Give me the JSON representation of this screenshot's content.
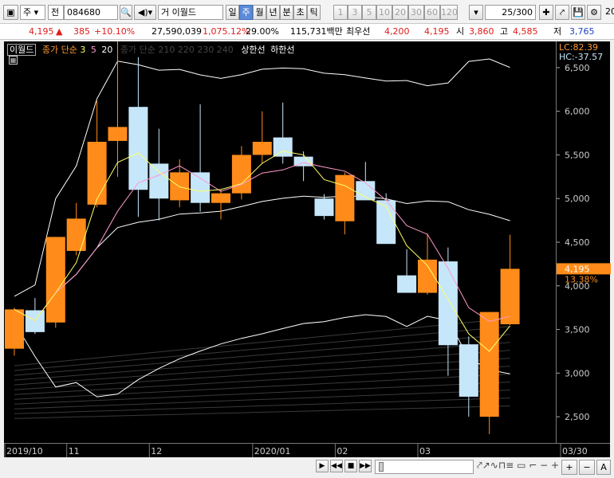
{
  "toolbar": {
    "market": "주",
    "all_label": "전",
    "code": "084680",
    "name": "거 이월드",
    "periods": [
      "일",
      "주",
      "월",
      "년",
      "분",
      "초",
      "틱"
    ],
    "selected_period": "주",
    "intervals": [
      "1",
      "3",
      "5",
      "10",
      "20",
      "30",
      "60",
      "120"
    ],
    "count": "25/300",
    "right_num": "20"
  },
  "quote": {
    "price": "4,195",
    "change": "385",
    "change_pct": "+10.10%",
    "volume": "27,590,039",
    "vol_ratio": "1,075.12%",
    "turnover": "29.00%",
    "amount": "115,731백만",
    "best_ask_label": "최우선",
    "best_ask": "4,200",
    "best_bid": "4,195",
    "open_label": "시",
    "open": "3,860",
    "high_label": "고",
    "high": "4,585",
    "low_label": "저",
    "low": "3,765"
  },
  "legend": {
    "name": "이월드",
    "ma_label": "종가 단순",
    "ma_periods": [
      "3",
      "5",
      "20"
    ],
    "ma_periods2": "종가 단순 210  220  230  240",
    "upper": "상한선",
    "lower": "하한선"
  },
  "axis_info": {
    "lc": "LC:82.39",
    "hc": "HC:-37.57",
    "current": "4,195",
    "current_pct": "13.38%"
  },
  "colors": {
    "up": "#ff8c1a",
    "down": "#c6e6fa",
    "bg": "#000000",
    "ma3": "#ffff66",
    "ma5": "#ff99cc",
    "band": "#ffffff"
  },
  "chart_data": {
    "type": "candlestick",
    "ylim": [
      2200,
      6800
    ],
    "yticks": [
      2500,
      3000,
      3500,
      4000,
      4500,
      5000,
      5500,
      6000,
      6500
    ],
    "x_labels": [
      {
        "label": "2019/10",
        "index": 0
      },
      {
        "label": "11",
        "index": 3
      },
      {
        "label": "12",
        "index": 7
      },
      {
        "label": "2020/01",
        "index": 12
      },
      {
        "label": "02",
        "index": 16
      },
      {
        "label": "03",
        "index": 20
      },
      {
        "label": "03/30",
        "index": 27
      }
    ],
    "candles": [
      {
        "o": 3280,
        "h": 3750,
        "l": 3200,
        "c": 3730
      },
      {
        "o": 3720,
        "h": 3860,
        "l": 3450,
        "c": 3470
      },
      {
        "o": 3580,
        "h": 4560,
        "l": 3520,
        "c": 4560
      },
      {
        "o": 4400,
        "h": 4950,
        "l": 4350,
        "c": 4770
      },
      {
        "o": 4930,
        "h": 6120,
        "l": 4900,
        "c": 5650
      },
      {
        "o": 5660,
        "h": 6800,
        "l": 5250,
        "c": 5820
      },
      {
        "o": 6050,
        "h": 6620,
        "l": 4790,
        "c": 5100
      },
      {
        "o": 5400,
        "h": 5800,
        "l": 4750,
        "c": 5000
      },
      {
        "o": 4980,
        "h": 5450,
        "l": 4900,
        "c": 5300
      },
      {
        "o": 5300,
        "h": 6080,
        "l": 4850,
        "c": 4950
      },
      {
        "o": 4950,
        "h": 5100,
        "l": 4760,
        "c": 5060
      },
      {
        "o": 5060,
        "h": 5600,
        "l": 4990,
        "c": 5500
      },
      {
        "o": 5500,
        "h": 6000,
        "l": 5400,
        "c": 5650
      },
      {
        "o": 5700,
        "h": 6100,
        "l": 5400,
        "c": 5480
      },
      {
        "o": 5480,
        "h": 5540,
        "l": 5200,
        "c": 5370
      },
      {
        "o": 5000,
        "h": 5050,
        "l": 4760,
        "c": 4800
      },
      {
        "o": 4740,
        "h": 5300,
        "l": 4590,
        "c": 5270
      },
      {
        "o": 5200,
        "h": 5420,
        "l": 4990,
        "c": 4980
      },
      {
        "o": 4980,
        "h": 5060,
        "l": 4480,
        "c": 4480
      },
      {
        "o": 4120,
        "h": 4420,
        "l": 3920,
        "c": 3920
      },
      {
        "o": 3920,
        "h": 4600,
        "l": 3900,
        "c": 4300
      },
      {
        "o": 4280,
        "h": 4440,
        "l": 2970,
        "c": 3320
      },
      {
        "o": 3330,
        "h": 3420,
        "l": 2500,
        "c": 2730
      },
      {
        "o": 2500,
        "h": 3700,
        "l": 2300,
        "c": 3700
      },
      {
        "o": 3560,
        "h": 4585,
        "l": 3550,
        "c": 4195
      }
    ]
  }
}
